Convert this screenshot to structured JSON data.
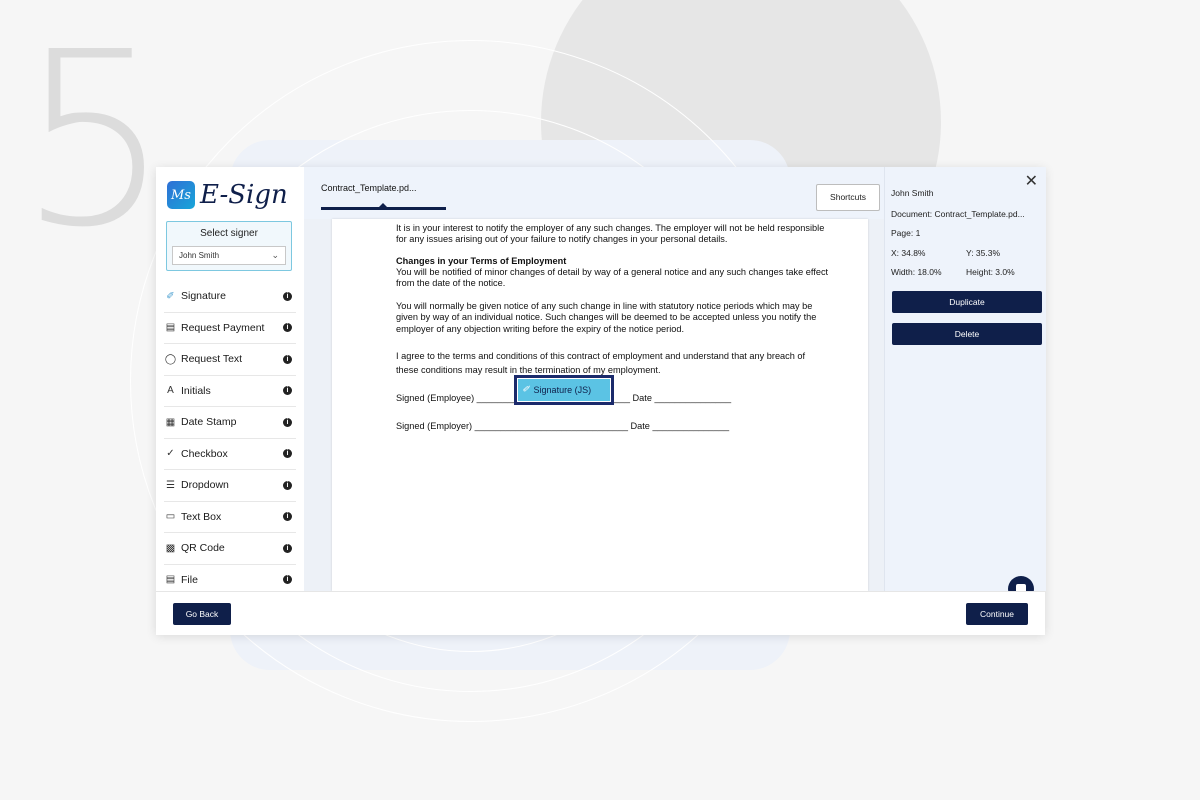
{
  "step_number": "5",
  "app": {
    "logo_text": "E-Sign",
    "logo_mark": "Ms",
    "signer": {
      "title": "Select signer",
      "selected": "John Smith"
    },
    "tools": [
      {
        "label": "Signature",
        "icon": "signature-icon"
      },
      {
        "label": "Request Payment",
        "icon": "card-icon"
      },
      {
        "label": "Request Text",
        "icon": "person-text-icon"
      },
      {
        "label": "Initials",
        "icon": "initials-icon"
      },
      {
        "label": "Date Stamp",
        "icon": "calendar-icon"
      },
      {
        "label": "Checkbox",
        "icon": "checkbox-icon"
      },
      {
        "label": "Dropdown",
        "icon": "dropdown-icon"
      },
      {
        "label": "Text Box",
        "icon": "textbox-icon"
      },
      {
        "label": "QR Code",
        "icon": "qr-icon"
      },
      {
        "label": "File",
        "icon": "file-icon"
      }
    ],
    "doc_tab": "Contract_Template.pd...",
    "shortcuts": "Shortcuts",
    "document": {
      "p1": "It is in your interest to notify the employer of any such changes. The employer will not be held responsible for any issues arising out of your failure to notify changes in your personal details.",
      "heading": "Changes in your Terms of Employment",
      "p2": "You will be notified of minor changes of detail by way of a general notice and any such changes take effect from the date of the notice.",
      "p3": "You will normally be given notice of any such change in line with statutory notice periods which may be given by way of an individual notice. Such changes will be deemed to be accepted unless you notify the employer of any objection writing before the expiry of the notice period.",
      "p4": "I agree to the terms and conditions of this contract of employment and understand that any breach of these conditions may result in the termination of my employment.",
      "signed_employee": "Signed (Employee) ______________________________  Date _______________",
      "signed_employer": "Signed (Employer) ______________________________  Date _______________",
      "signature_field": "Signature (JS)"
    },
    "properties": {
      "name": "John Smith",
      "document": "Document: Contract_Template.pd...",
      "page": "Page: 1",
      "x": "X: 34.8%",
      "y": "Y: 35.3%",
      "width": "Width: 18.0%",
      "height": "Height: 3.0%",
      "duplicate": "Duplicate",
      "delete": "Delete"
    },
    "footer": {
      "back": "Go Back",
      "continue": "Continue"
    }
  }
}
